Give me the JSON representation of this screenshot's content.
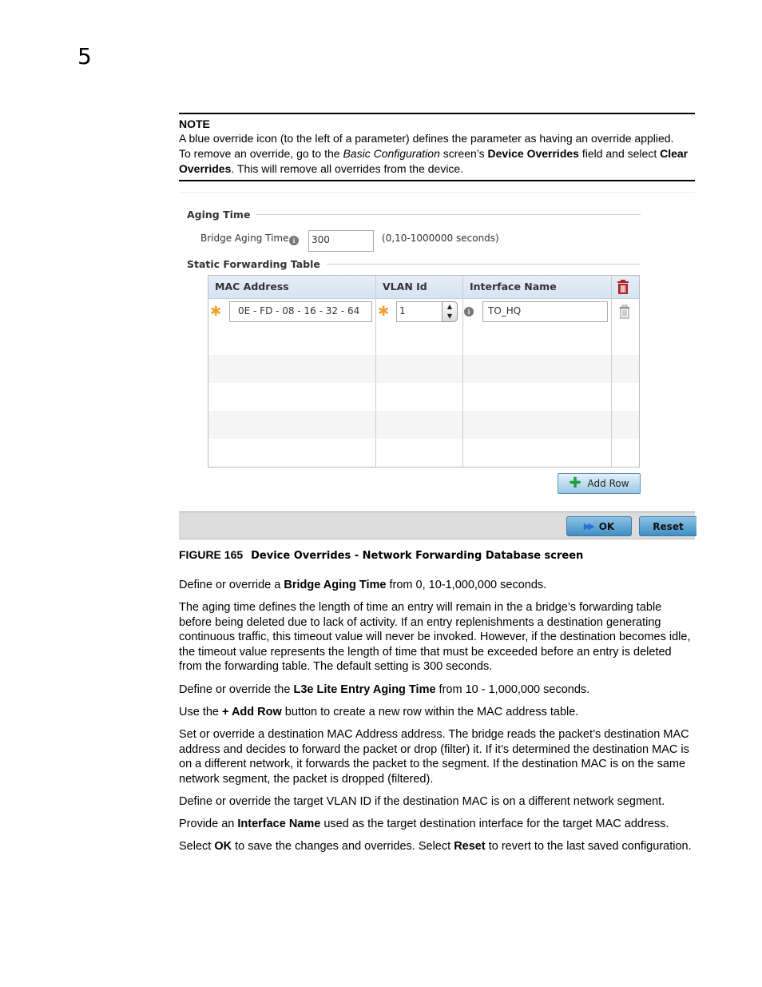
{
  "chapter_number": "5",
  "note": {
    "title": "NOTE",
    "line1": "A blue override icon (to the left of a parameter) defines the parameter as having an override applied.",
    "line2_pre": "To remove an override, go to the ",
    "line2_italic": "Basic Configuration",
    "line2_mid": " screen’s ",
    "line2_bold1": "Device Overrides",
    "line2_mid2": " field and select ",
    "line2_bold2": "Clear Overrides",
    "line2_post": ". This will remove all overrides from the device."
  },
  "figure": {
    "aging_section": "Aging Time",
    "bridge_aging_label": "Bridge Aging Time",
    "bridge_aging_value": "300",
    "bridge_aging_range": "(0,10-1000000 seconds)",
    "static_section": "Static Forwarding Table",
    "table": {
      "columns": [
        "MAC Address",
        "VLAN Id",
        "Interface Name"
      ],
      "rows": [
        {
          "mac": "0E - FD - 08 - 16 - 32 - 64",
          "vlan": "1",
          "interface": "TO_HQ"
        }
      ]
    },
    "add_row_label": "Add Row",
    "ok_label": "OK",
    "reset_label": "Reset"
  },
  "caption": {
    "number": "FIGURE 165",
    "text": "Device Overrides - Network Forwarding Database screen"
  },
  "paragraphs": {
    "p1": {
      "pre": "Define or override a ",
      "bold": "Bridge Aging Time",
      "post": " from 0, 10-1,000,000 seconds."
    },
    "p2": "The aging time defines the length of time an entry will remain in the a bridge’s forwarding table before being deleted due to lack of activity. If an entry replenishments a destination generating continuous traffic, this timeout value will never be invoked. However, if the destination becomes idle, the timeout value represents the length of time that must be exceeded before an entry is deleted from the forwarding table. The default setting is 300 seconds.",
    "p3": {
      "pre": "Define or override the ",
      "bold": "L3e Lite Entry Aging Time",
      "post": " from 10 - 1,000,000 seconds."
    },
    "p4": {
      "pre": "Use the ",
      "bold": "+ Add Row",
      "post": " button to create a new row within the MAC address table."
    },
    "p5": "Set or override a destination MAC Address address. The bridge reads the packet’s destination MAC address and decides to forward the packet or drop (filter) it. If it’s determined the destination MAC is on a different network, it forwards the packet to the segment. If the destination MAC is on the same network segment, the packet is dropped (filtered).",
    "p6": "Define or override the target VLAN ID if the destination MAC is on a different network segment.",
    "p7": {
      "pre": "Provide an ",
      "bold": "Interface Name",
      "post": " used as the target destination interface for the target MAC address."
    },
    "p8": {
      "pre": "Select ",
      "bold1": "OK",
      "mid": " to save the changes and overrides. Select ",
      "bold2": "Reset",
      "post": " to revert to the last saved configuration."
    }
  },
  "colors": {
    "accent_orange": "#f0a030",
    "delete_red": "#b22222",
    "header_blue": "#d6e3f2",
    "button_blue": "#3f8fc3"
  }
}
